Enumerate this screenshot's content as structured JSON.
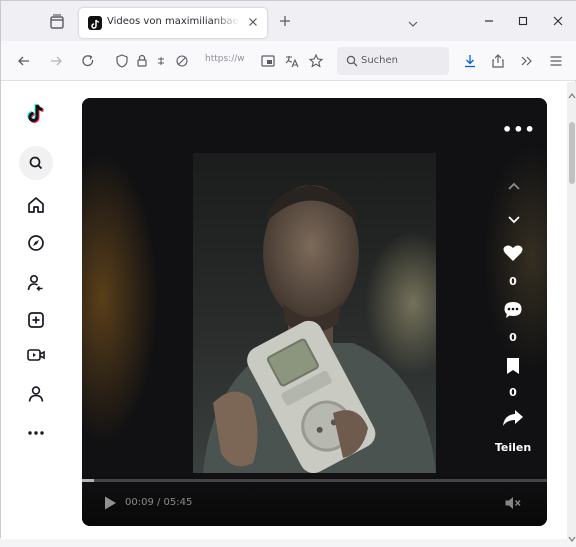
{
  "browser": {
    "tab": {
      "title": "Videos von maximilianbaehring"
    },
    "url": {
      "text": "https://w"
    },
    "search": {
      "placeholder": "Suchen"
    }
  },
  "player": {
    "likes": "0",
    "comments": "0",
    "saves": "0",
    "share_label": "Teilen",
    "time": "00:09 / 05:45",
    "progress_fraction": 0.026
  }
}
